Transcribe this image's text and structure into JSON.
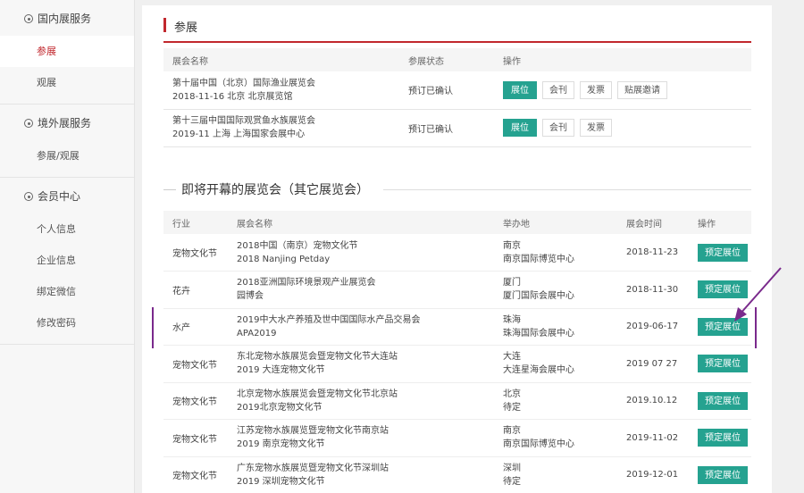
{
  "sidebar": {
    "sections": [
      {
        "title": "国内展服务",
        "items": [
          {
            "label": "参展",
            "active": true
          },
          {
            "label": "观展",
            "active": false
          }
        ]
      },
      {
        "title": "境外展服务",
        "items": [
          {
            "label": "参展/观展",
            "active": false
          }
        ]
      },
      {
        "title": "会员中心",
        "items": [
          {
            "label": "个人信息",
            "active": false
          },
          {
            "label": "企业信息",
            "active": false
          },
          {
            "label": "绑定微信",
            "active": false
          },
          {
            "label": "修改密码",
            "active": false
          }
        ]
      }
    ]
  },
  "participation": {
    "title": "参展",
    "headers": [
      "展会名称",
      "参展状态",
      "操作"
    ],
    "rows": [
      {
        "name": "第十届中国（北京）国际渔业展览会",
        "meta": "2018-11-16   北京   北京展览馆",
        "status": "预订已确认",
        "actions": [
          "展位",
          "会刊",
          "发票",
          "贴展邀请"
        ]
      },
      {
        "name": "第十三届中国国际观赏鱼水族展览会",
        "meta": "2019-11   上海   上海国家会展中心",
        "status": "预订已确认",
        "actions": [
          "展位",
          "会刊",
          "发票"
        ]
      }
    ]
  },
  "upcoming": {
    "title": "即将开幕的展览会（其它展览会）",
    "headers": [
      "行业",
      "展会名称",
      "举办地",
      "展会时间",
      "操作"
    ],
    "rows": [
      {
        "industry": "宠物文化节",
        "name": "2018中国（南京）宠物文化节",
        "sub": "2018 Nanjing Petday",
        "city": "南京",
        "venue": "南京国际博览中心",
        "date": "2018-11-23",
        "action": "预定展位"
      },
      {
        "industry": "花卉",
        "name": "2018亚洲国际环境景观产业展览会",
        "sub": "园博会",
        "city": "厦门",
        "venue": "厦门国际会展中心",
        "date": "2018-11-30",
        "action": "预定展位"
      },
      {
        "industry": "水产",
        "name": "2019中大水产养殖及世中国国际水产品交易会",
        "sub": "APA2019",
        "city": "珠海",
        "venue": "珠海国际会展中心",
        "date": "2019-06-17",
        "action": "预定展位"
      },
      {
        "industry": "宠物文化节",
        "name": "东北宠物水族展览会暨宠物文化节大连站",
        "sub": "2019 大连宠物文化节",
        "city": "大连",
        "venue": "大连星海会展中心",
        "date": "2019 07 27",
        "action": "预定展位"
      },
      {
        "industry": "宠物文化节",
        "name": "北京宠物水族展览会暨宠物文化节北京站",
        "sub": "2019北京宠物文化节",
        "city": "北京",
        "venue": "待定",
        "date": "2019.10.12",
        "action": "预定展位"
      },
      {
        "industry": "宠物文化节",
        "name": "江苏宠物水族展览暨宠物文化节南京站",
        "sub": "2019 南京宠物文化节",
        "city": "南京",
        "venue": "南京国际博览中心",
        "date": "2019-11-02",
        "action": "预定展位"
      },
      {
        "industry": "宠物文化节",
        "name": "广东宠物水族展览暨宠物文化节深圳站",
        "sub": "2019 深圳宠物文化节",
        "city": "深圳",
        "venue": "待定",
        "date": "2019-12-01",
        "action": "预定展位"
      }
    ]
  },
  "colors": {
    "accent": "#c1272d",
    "button": "#25a290",
    "annotation": "#7a2a8c"
  }
}
